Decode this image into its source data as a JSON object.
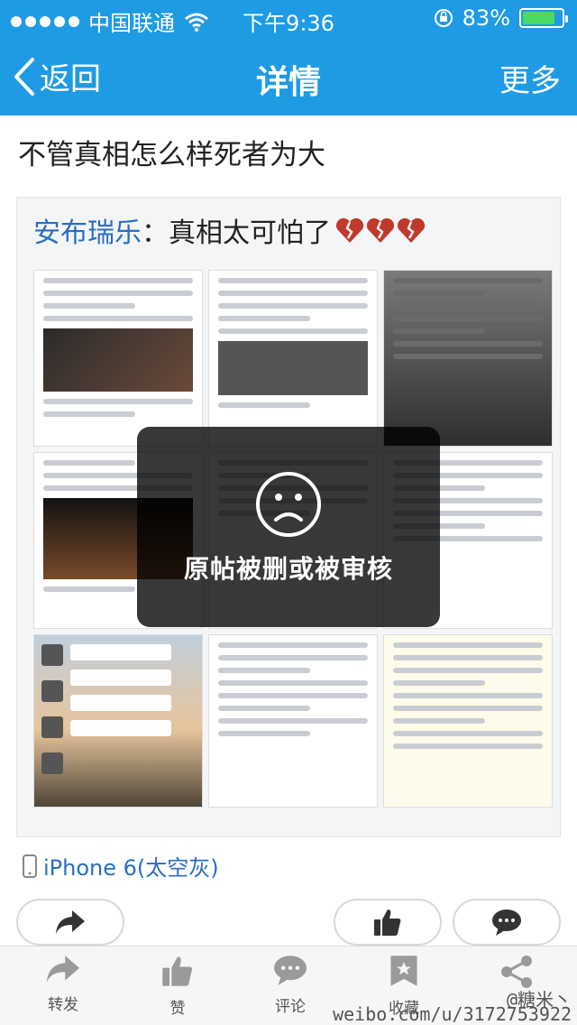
{
  "status_bar": {
    "carrier": "中国联通",
    "time": "下午9:36",
    "battery": "83%",
    "battery_level": 0.83
  },
  "nav": {
    "back_label": "返回",
    "title": "详情",
    "more_label": "更多"
  },
  "post": {
    "text": "不管真相怎么样死者为大"
  },
  "repost": {
    "author": "安布瑞乐",
    "separator": "：",
    "text": "真相太可怕了"
  },
  "overlay": {
    "message": "原帖被删或被审核"
  },
  "device": {
    "label": "iPhone 6(太空灰)"
  },
  "tab_bar": {
    "repost": "转发",
    "like": "赞",
    "comment": "评论",
    "favorite": "收藏"
  },
  "watermark": {
    "handle": "@糖米丶",
    "url": "weibo.com/u/3172753922"
  },
  "colors": {
    "brand": "#1e9be4",
    "link": "#2a6ec2",
    "heart": "#c0392b"
  }
}
